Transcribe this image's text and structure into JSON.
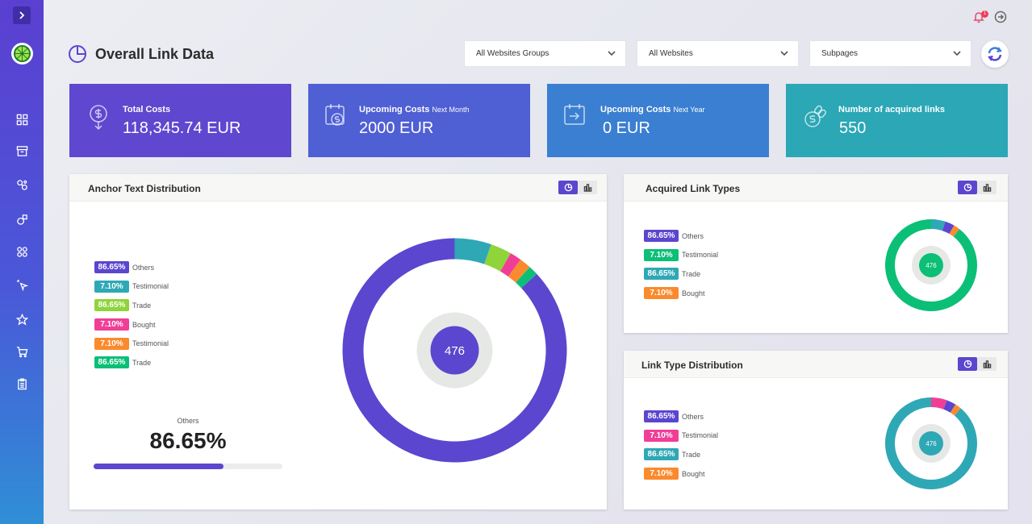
{
  "header": {
    "title": "Overall Link Data"
  },
  "notifications": {
    "badge": "1"
  },
  "filters": {
    "groups": "All Websites Groups",
    "websites": "All Websites",
    "subpages": "Subpages"
  },
  "stats": [
    {
      "label": "Total Costs",
      "sub": "",
      "value": "118,345.74 EUR",
      "color": "#5f47cf"
    },
    {
      "label": "Upcoming Costs",
      "sub": "Next Month",
      "value": "2000 EUR",
      "color": "#4f5fd4"
    },
    {
      "label": "Upcoming Costs",
      "sub": "Next Year",
      "value": "0 EUR",
      "color": "#3a7fd1"
    },
    {
      "label": "Number of acquired links",
      "sub": "",
      "value": "550",
      "color": "#2ba7b6"
    }
  ],
  "colors": {
    "accent": "#5b46cf",
    "teal": "#2fa8b6",
    "lime": "#8fd43a",
    "pink": "#f03e97",
    "orange": "#fb8a2c",
    "green": "#0bbf77"
  },
  "anchor_panel": {
    "title": "Anchor Text Distribution",
    "legend": [
      {
        "pct": "86.65%",
        "label": "Others",
        "color": "#5b46cf"
      },
      {
        "pct": "7.10%",
        "label": "Testimonial",
        "color": "#2fa8b6"
      },
      {
        "pct": "86.65%",
        "label": "Trade",
        "color": "#8fd43a"
      },
      {
        "pct": "7.10%",
        "label": "Bought",
        "color": "#f03e97"
      },
      {
        "pct": "7.10%",
        "label": "Testimonial",
        "color": "#fb8a2c"
      },
      {
        "pct": "86.65%",
        "label": "Trade",
        "color": "#0bbf77"
      }
    ],
    "highlight": {
      "caption": "Others",
      "value": "86.65%",
      "progress": 0.69
    },
    "center": "476",
    "segments": [
      {
        "color": "#2fa8b6",
        "deg": 19
      },
      {
        "color": "#8fd43a",
        "deg": 11
      },
      {
        "color": "#f03e97",
        "deg": 6
      },
      {
        "color": "#fb8a2c",
        "deg": 6
      },
      {
        "color": "#0bbf77",
        "deg": 5
      },
      {
        "color": "#5b46cf",
        "deg": 313
      }
    ]
  },
  "acquired_panel": {
    "title": "Acquired Link Types",
    "legend": [
      {
        "pct": "86.65%",
        "label": "Others",
        "color": "#5b46cf"
      },
      {
        "pct": "7.10%",
        "label": "Testimonial",
        "color": "#0bbf77"
      },
      {
        "pct": "86.65%",
        "label": "Trade",
        "color": "#2fa8b6"
      },
      {
        "pct": "7.10%",
        "label": "Bought",
        "color": "#fb8a2c"
      }
    ],
    "center": "476",
    "segments": [
      {
        "color": "#2fa8b6",
        "deg": 18
      },
      {
        "color": "#5b46cf",
        "deg": 12
      },
      {
        "color": "#fb8a2c",
        "deg": 8
      },
      {
        "color": "#0bbf77",
        "deg": 322
      }
    ]
  },
  "linktype_panel": {
    "title": "Link Type Distribution",
    "legend": [
      {
        "pct": "86.65%",
        "label": "Others",
        "color": "#5b46cf"
      },
      {
        "pct": "7.10%",
        "label": "Testimonial",
        "color": "#f03e97"
      },
      {
        "pct": "86.65%",
        "label": "Trade",
        "color": "#2fa8b6"
      },
      {
        "pct": "7.10%",
        "label": "Bought",
        "color": "#fb8a2c"
      }
    ],
    "center": "476",
    "segments": [
      {
        "color": "#f03e97",
        "deg": 20
      },
      {
        "color": "#5b46cf",
        "deg": 12
      },
      {
        "color": "#fb8a2c",
        "deg": 8
      },
      {
        "color": "#2fa8b6",
        "deg": 320
      }
    ]
  }
}
